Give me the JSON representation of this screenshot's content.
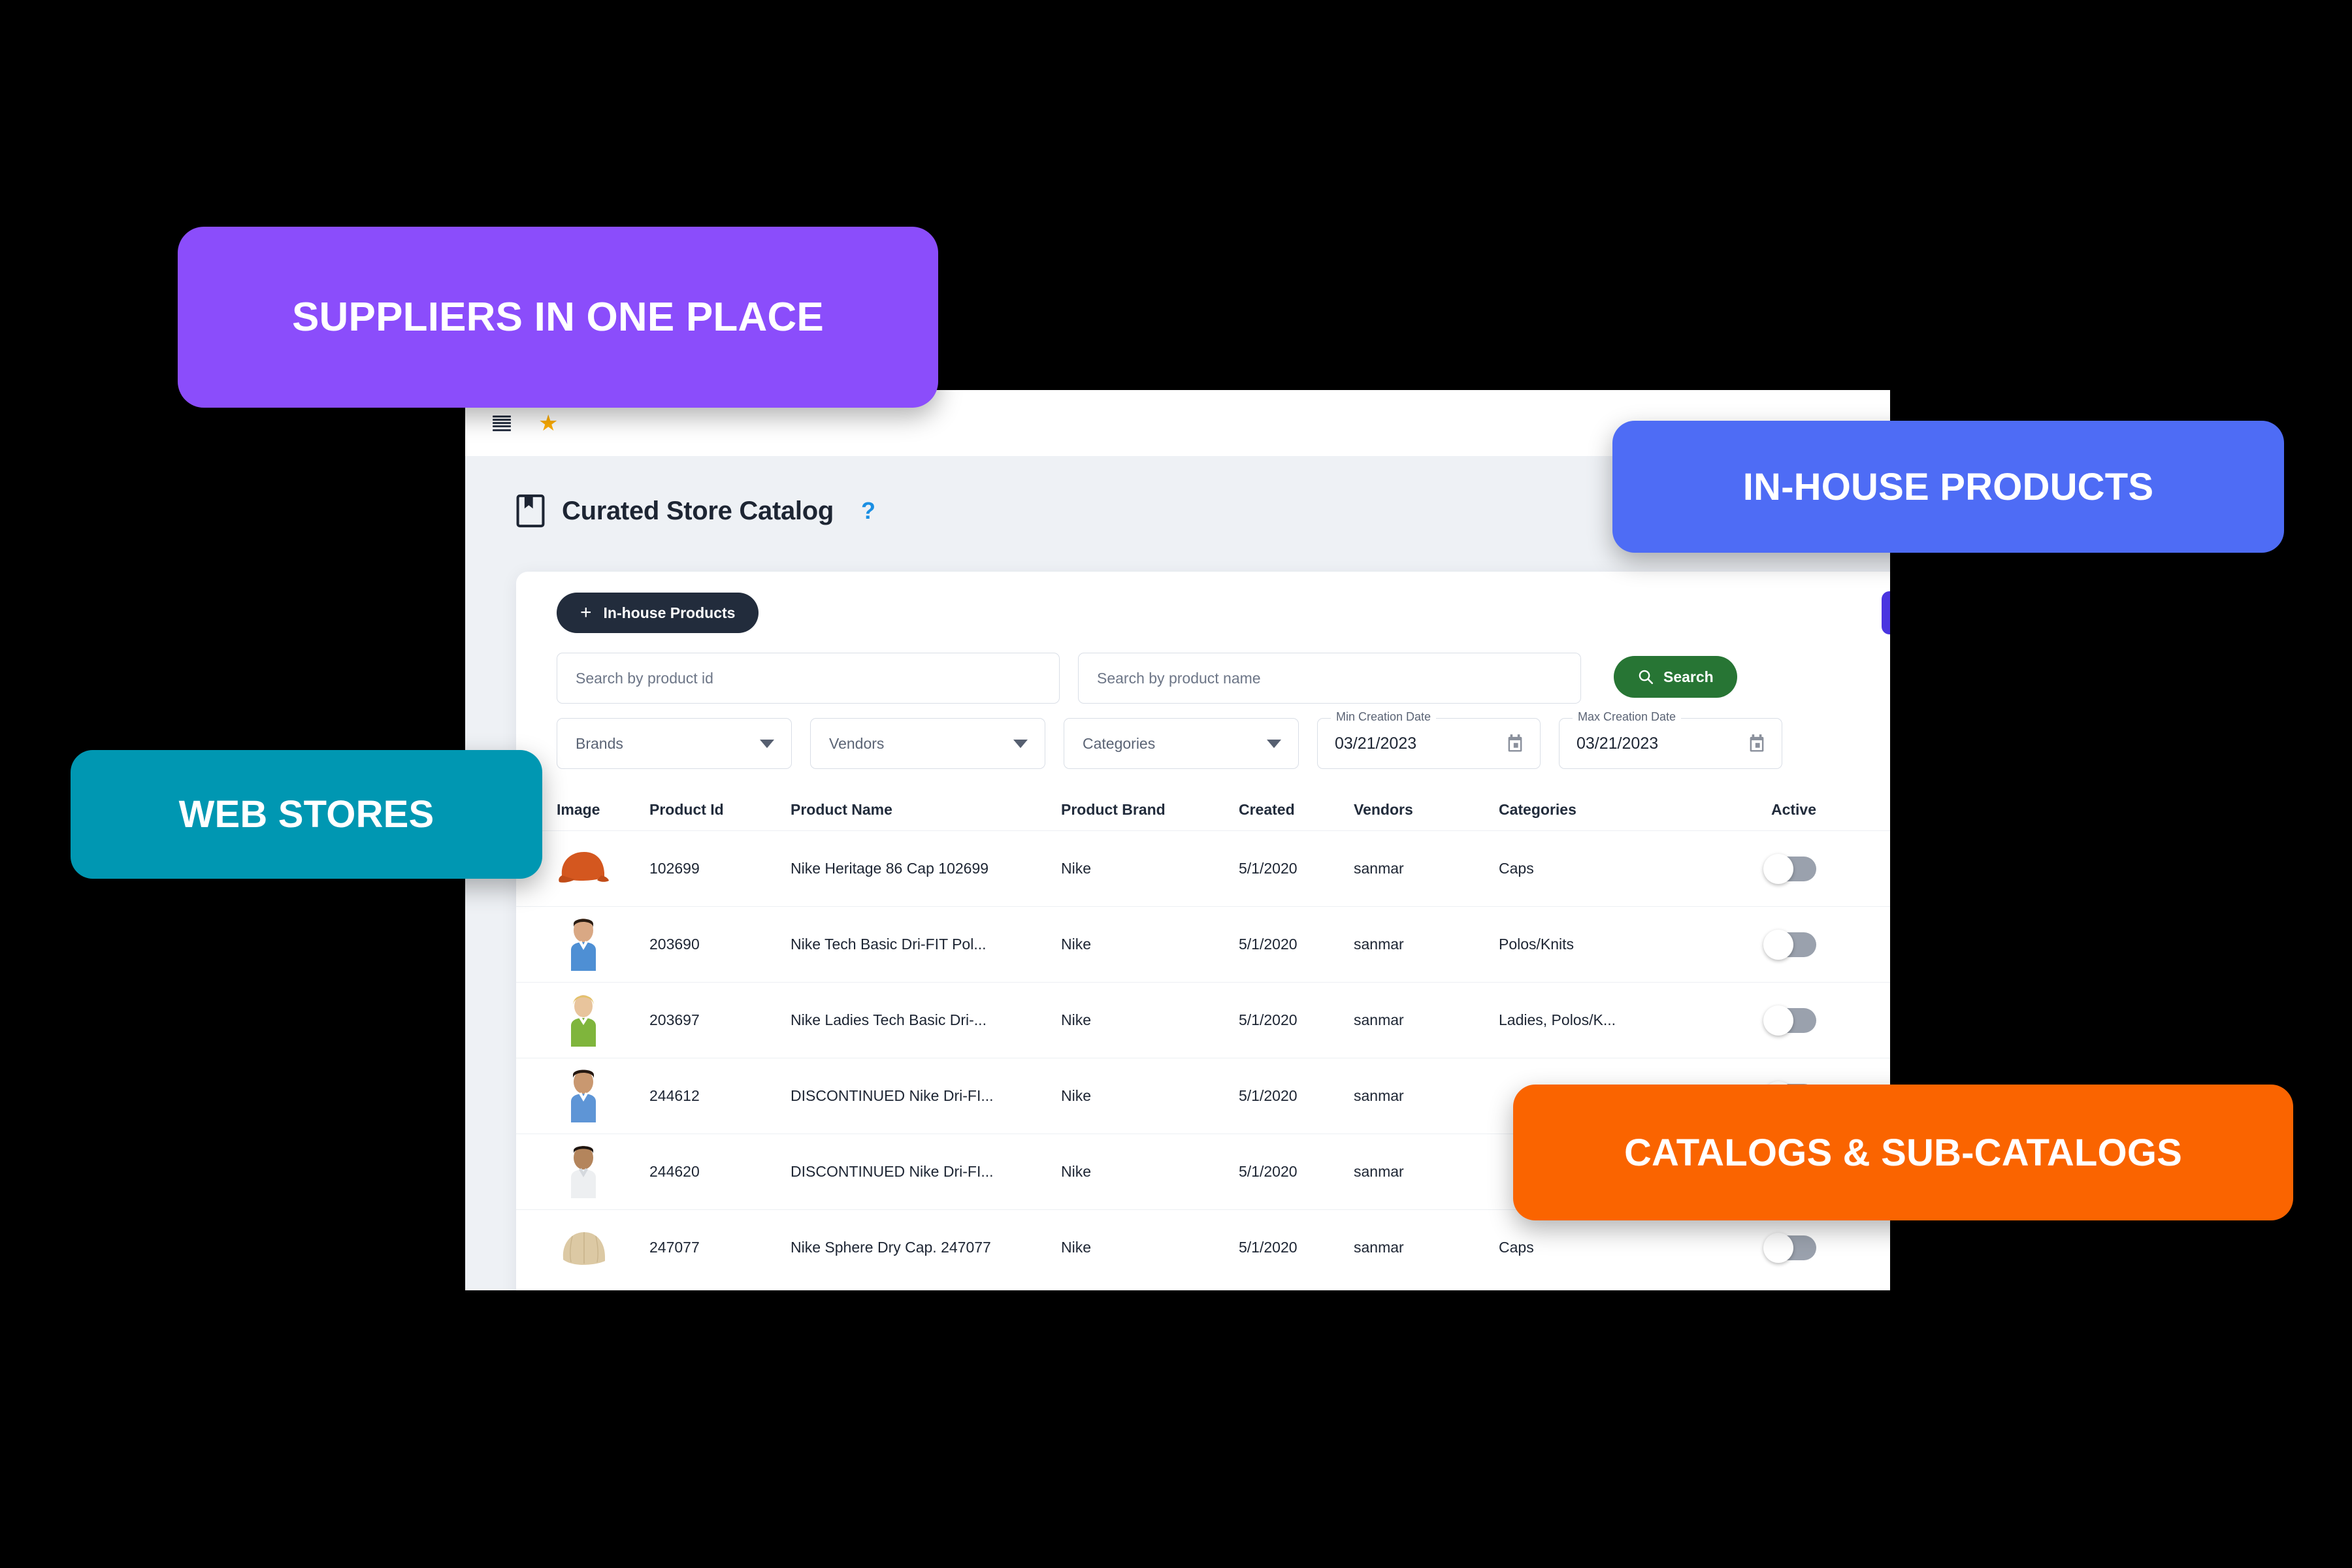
{
  "window": {
    "topbar": {
      "menu_icon": "hamburger-icon",
      "favorite_icon": "star-icon"
    },
    "header": {
      "icon": "bookmark-book-icon",
      "title": "Curated Store Catalog",
      "help": "?"
    }
  },
  "toolbar": {
    "inhouse_plus": "+",
    "inhouse_label": "In-house Products",
    "upload_icon": "folder-upload-icon"
  },
  "filters": {
    "product_id": {
      "value": "",
      "placeholder": "Search by product id"
    },
    "product_name": {
      "value": "",
      "placeholder": "Search by product name"
    },
    "search_button": "Search",
    "search_icon": "magnifier-icon",
    "brands": {
      "label": "Brands",
      "value": ""
    },
    "vendors": {
      "label": "Vendors",
      "value": ""
    },
    "categories": {
      "label": "Categories",
      "value": ""
    },
    "min_creation_date": {
      "legend": "Min Creation Date",
      "value": "03/21/2023"
    },
    "max_creation_date": {
      "legend": "Max Creation Date",
      "value": "03/21/2023"
    }
  },
  "table": {
    "columns": [
      "Image",
      "Product Id",
      "Product Name",
      "Product Brand",
      "Created",
      "Vendors",
      "Categories",
      "Active"
    ],
    "rows": [
      {
        "image": "orange-cap-thumbnail",
        "product_id": "102699",
        "product_name": "Nike Heritage 86 Cap 102699",
        "product_brand": "Nike",
        "created": "5/1/2020",
        "vendors": "sanmar",
        "categories": "Caps",
        "active": false
      },
      {
        "image": "blue-polo-man-thumbnail",
        "product_id": "203690",
        "product_name": "Nike Tech Basic Dri-FIT Pol...",
        "product_brand": "Nike",
        "created": "5/1/2020",
        "vendors": "sanmar",
        "categories": "Polos/Knits",
        "active": false
      },
      {
        "image": "green-polo-woman-thumbnail",
        "product_id": "203697",
        "product_name": "Nike Ladies Tech Basic Dri-...",
        "product_brand": "Nike",
        "created": "5/1/2020",
        "vendors": "sanmar",
        "categories": "Ladies, Polos/K...",
        "active": false
      },
      {
        "image": "blue-polo-man2-thumbnail",
        "product_id": "244612",
        "product_name": "DISCONTINUED Nike Dri-FI...",
        "product_brand": "Nike",
        "created": "5/1/2020",
        "vendors": "sanmar",
        "categories": "",
        "active": false
      },
      {
        "image": "white-polo-man-thumbnail",
        "product_id": "244620",
        "product_name": "DISCONTINUED Nike Dri-FI...",
        "product_brand": "Nike",
        "created": "5/1/2020",
        "vendors": "sanmar",
        "categories": "",
        "active": false
      },
      {
        "image": "tan-cap-thumbnail",
        "product_id": "247077",
        "product_name": "Nike Sphere Dry Cap. 247077",
        "product_brand": "Nike",
        "created": "5/1/2020",
        "vendors": "sanmar",
        "categories": "Caps",
        "active": false
      }
    ]
  },
  "badges": {
    "suppliers": {
      "label": "SUPPLIERS IN ONE PLACE",
      "color": "#8B4DFB"
    },
    "inhouse": {
      "label": "IN-HOUSE PRODUCTS",
      "color": "#4E6CF5"
    },
    "webstores": {
      "label": "WEB STORES",
      "color": "#0097B2"
    },
    "catalogs": {
      "label": "CATALOGS & SUB-CATALOGS",
      "color": "#FA6400"
    }
  }
}
